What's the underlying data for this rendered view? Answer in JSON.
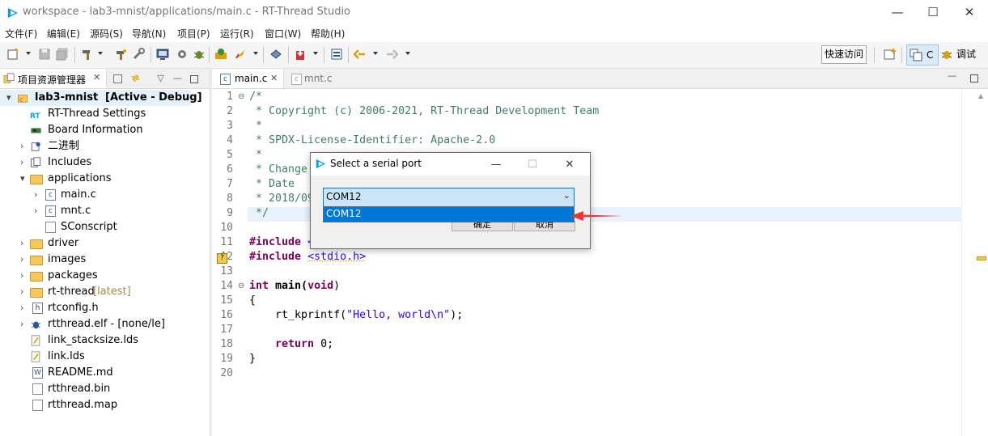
{
  "window": {
    "title": "workspace - lab3-mnist/applications/main.c - RT-Thread Studio",
    "minimize": "—",
    "maximize": "☐",
    "close": "✕"
  },
  "menu": [
    "文件(F)",
    "编辑(E)",
    "源码(S)",
    "导航(N)",
    "项目(P)",
    "运行(R)",
    "窗口(W)",
    "帮助(H)"
  ],
  "toolbar": {
    "quick_access": "快速访问",
    "perspective_c": "C",
    "perspective_debug": "调试"
  },
  "project_explorer": {
    "tab_label": "项目资源管理器",
    "close": "✕",
    "project_name": "lab3-mnist",
    "project_status": "[Active - Debug]",
    "items": [
      {
        "label": "RT-Thread Settings"
      },
      {
        "label": "Board Information"
      },
      {
        "label": "二进制"
      },
      {
        "label": "Includes"
      },
      {
        "label": "applications"
      },
      {
        "label": "main.c"
      },
      {
        "label": "mnt.c"
      },
      {
        "label": "SConscript"
      },
      {
        "label": "driver"
      },
      {
        "label": "images"
      },
      {
        "label": "packages"
      },
      {
        "label": "rt-thread",
        "suffix": "[latest]"
      },
      {
        "label": "rtconfig.h"
      },
      {
        "label": "rtthread.elf - [none/le]"
      },
      {
        "label": "link_stacksize.lds"
      },
      {
        "label": "link.lds"
      },
      {
        "label": "README.md"
      },
      {
        "label": "rtthread.bin"
      },
      {
        "label": "rtthread.map"
      }
    ]
  },
  "editor": {
    "tabs": [
      {
        "label": "main.c",
        "close": "✕"
      },
      {
        "label": "mnt.c"
      }
    ],
    "line_numbers": [
      "1",
      "2",
      "3",
      "4",
      "5",
      "6",
      "7",
      "8",
      "9",
      "10",
      "11",
      "12",
      "13",
      "14",
      "15",
      "16",
      "17",
      "18",
      "19",
      "20"
    ],
    "code": {
      "l1": "/*",
      "l2": " * Copyright (c) 2006-2021, RT-Thread Development Team",
      "l3": " *",
      "l4": " * SPDX-License-Identifier: Apache-2.0",
      "l5": " *",
      "l6": " * Change",
      "l7": " * Date",
      "l8": " * 2018/09",
      "l9": " */",
      "l11_kw": "#include",
      "l11_rest": " <",
      "l12_kw": "#include",
      "l12_inc": "<stdio.h>",
      "l14_kw": "int",
      "l14_rest": " main(",
      "l14_void": "void",
      "l14_close": ")",
      "l15": "{",
      "l16_pre": "    rt_kprintf(",
      "l16_str": "\"Hello, world\\n\"",
      "l16_post": ");",
      "l18_kw": "    return",
      "l18_rest": " 0;",
      "l19": "}"
    }
  },
  "dialog": {
    "title": "Select a serial port",
    "selected_port": "COM12",
    "options": [
      "COM12"
    ],
    "ok_label": "确定",
    "cancel_label": "取消",
    "minimize": "—",
    "maximize": "☐",
    "close": "✕"
  },
  "colors": {
    "accent": "#0078d7",
    "annotation_arrow": "#e8382f",
    "comment": "#3f7f5f",
    "keyword": "#7f0055",
    "string": "#2a00ff"
  }
}
